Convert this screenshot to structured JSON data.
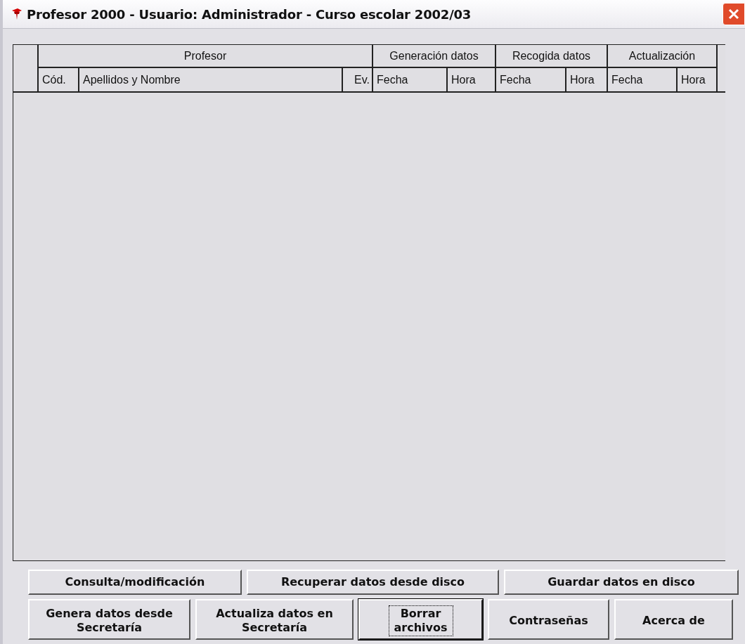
{
  "window": {
    "title": "Profesor 2000 - Usuario: Administrador - Curso escolar 2002/03"
  },
  "table": {
    "column_groups": [
      {
        "label": "Profesor",
        "columns": [
          "Cód.",
          "Apellidos y Nombre",
          "Ev."
        ]
      },
      {
        "label": "Generación datos",
        "columns": [
          "Fecha",
          "Hora"
        ]
      },
      {
        "label": "Recogida datos",
        "columns": [
          "Fecha",
          "Hora"
        ]
      },
      {
        "label": "Actualización",
        "columns": [
          "Fecha",
          "Hora"
        ]
      }
    ]
  },
  "button_rows": [
    [
      {
        "label": "Consulta/modificación",
        "focused": false
      },
      {
        "label": "Recuperar datos desde disco",
        "focused": false
      },
      {
        "label": "Guardar datos en disco",
        "focused": false
      }
    ],
    [
      {
        "label": "Genera datos desde\nSecretaría",
        "focused": false
      },
      {
        "label": "Actualiza datos en\nSecretaría",
        "focused": false
      },
      {
        "label": "Borrar\narchivos",
        "focused": true
      },
      {
        "label": "Contraseñas",
        "focused": false
      },
      {
        "label": "Acerca de",
        "focused": false
      }
    ]
  ]
}
